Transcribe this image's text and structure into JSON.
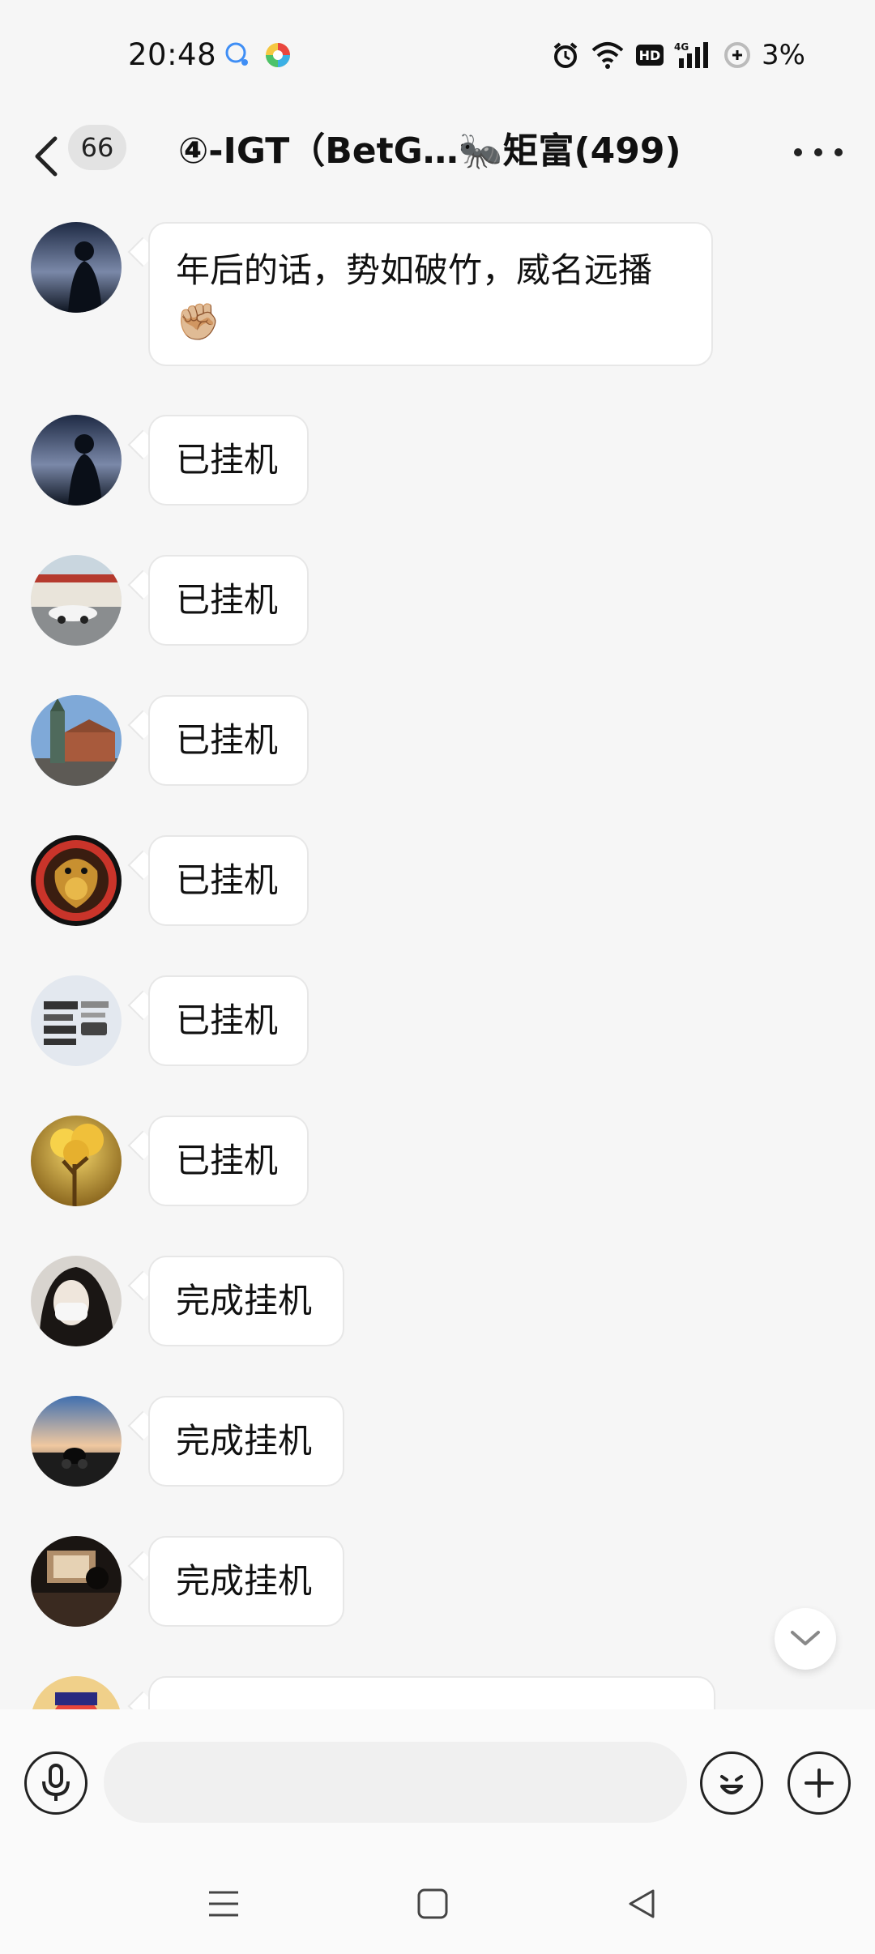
{
  "status_bar": {
    "time": "20:48",
    "battery": "3%",
    "icons": [
      "chat-app-icon",
      "colorful-app-icon",
      "alarm-icon",
      "wifi-icon",
      "hd-icon",
      "4g-signal-icon",
      "battery-icon"
    ]
  },
  "header": {
    "unread_count": "66",
    "title": "④-IGT（BetG…🐜矩富(499)"
  },
  "messages": [
    {
      "avatar": "sunset-silhouette",
      "text": "年后的话，势如破竹，威名远播",
      "emoji": "✊🏼"
    },
    {
      "avatar": "sunset-silhouette",
      "text": "已挂机"
    },
    {
      "avatar": "white-car-building",
      "text": "已挂机"
    },
    {
      "avatar": "church-tower",
      "text": "已挂机"
    },
    {
      "avatar": "golden-dragon",
      "text": "已挂机"
    },
    {
      "avatar": "text-meme",
      "text": "已挂机"
    },
    {
      "avatar": "golden-tree",
      "text": "已挂机"
    },
    {
      "avatar": "masked-girl",
      "text": "完成挂机"
    },
    {
      "avatar": "motorbike-dusk",
      "text": "完成挂机"
    },
    {
      "avatar": "dark-interior",
      "text": "完成挂机"
    },
    {
      "avatar": "colorful-figure",
      "text": ""
    }
  ],
  "input": {
    "placeholder": ""
  },
  "colors": {
    "background": "#f6f6f6",
    "bubble": "#ffffff",
    "bubble_border": "#e7e7e7"
  }
}
